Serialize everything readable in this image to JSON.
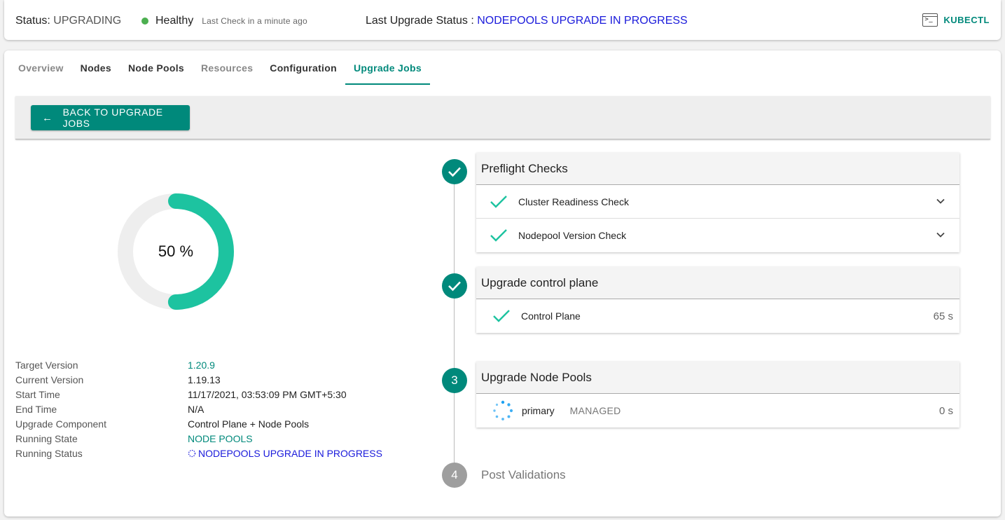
{
  "topbar": {
    "status_label": "Status:",
    "status_value": "UPGRADING",
    "health": "Healthy",
    "last_check": "Last Check in a minute ago",
    "upgrade_label": "Last Upgrade Status :",
    "upgrade_value": "NODEPOOLS UPGRADE IN PROGRESS",
    "kubectl": "KUBECTL",
    "kubectl_icon_glyph": ">_"
  },
  "tabs": [
    {
      "label": "Overview",
      "state": "dim"
    },
    {
      "label": "Nodes",
      "state": "normal"
    },
    {
      "label": "Node Pools",
      "state": "normal"
    },
    {
      "label": "Resources",
      "state": "dim"
    },
    {
      "label": "Configuration",
      "state": "normal"
    },
    {
      "label": "Upgrade Jobs",
      "state": "active"
    }
  ],
  "back_button": {
    "arrow": "←",
    "label": "BACK TO UPGRADE JOBS"
  },
  "progress": {
    "label": "50 %",
    "fraction": 0.5
  },
  "details": [
    {
      "key": "Target Version",
      "value": "1.20.9",
      "style": "teal"
    },
    {
      "key": "Current Version",
      "value": "1.19.13",
      "style": "plain"
    },
    {
      "key": "Start Time",
      "value": "11/17/2021, 03:53:09 PM GMT+5:30",
      "style": "plain"
    },
    {
      "key": "End Time",
      "value": "N/A",
      "style": "plain"
    },
    {
      "key": "Upgrade Component",
      "value": "Control Plane + Node Pools",
      "style": "plain"
    },
    {
      "key": "Running State",
      "value": "NODE POOLS",
      "style": "teal"
    },
    {
      "key": "Running Status",
      "value": "NODEPOOLS UPGRADE IN PROGRESS",
      "style": "blue"
    }
  ],
  "steps": {
    "preflight": {
      "title": "Preflight Checks",
      "items": [
        {
          "label": "Cluster Readiness Check"
        },
        {
          "label": "Nodepool Version Check"
        }
      ]
    },
    "control_plane": {
      "title": "Upgrade control plane",
      "items": [
        {
          "label": "Control Plane",
          "duration": "65 s"
        }
      ]
    },
    "node_pools": {
      "number": "3",
      "title": "Upgrade Node Pools",
      "items": [
        {
          "label": "primary",
          "tag": "MANAGED",
          "duration": "0 s"
        }
      ]
    },
    "post": {
      "number": "4",
      "title": "Post Validations"
    }
  },
  "colors": {
    "accent": "#00897b",
    "donut": "#1dc3a0",
    "donut_track": "#eeeeee",
    "link_blue": "#1a1adb",
    "spinner": "#1da1f2"
  }
}
